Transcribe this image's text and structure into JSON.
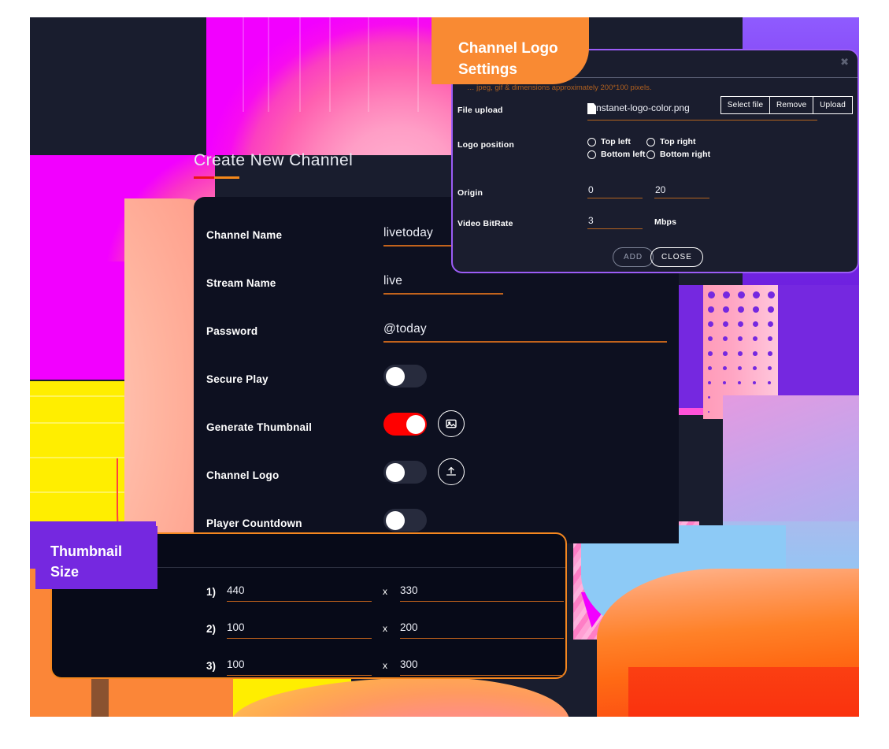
{
  "page": {
    "title": "Create New Channel"
  },
  "form": {
    "fields": [
      {
        "label": "Channel Name",
        "value": "livetoday",
        "type": "text",
        "underline_width": 152
      },
      {
        "label": "Stream Name",
        "value": "live",
        "type": "text",
        "underline_width": 152
      },
      {
        "label": "Password",
        "value": "@today",
        "type": "text",
        "underline_width": 360
      },
      {
        "label": "Secure Play",
        "type": "toggle",
        "on": false,
        "icon": null
      },
      {
        "label": "Generate Thumbnail",
        "type": "toggle",
        "on": true,
        "icon": "image-icon"
      },
      {
        "label": "Channel Logo",
        "type": "toggle",
        "on": false,
        "icon": "upload-icon"
      },
      {
        "label": "Player Countdown",
        "type": "toggle",
        "on": false,
        "icon": null
      }
    ]
  },
  "badges": {
    "logo_settings": "Channel Logo\nSettings",
    "thumbnail_size": "Thumbnail\nSize"
  },
  "modal": {
    "close_icon": "✖",
    "hint": "…  jpeg, gif & dimensions approximately 200*100 pixels.",
    "file_upload": {
      "label": "File upload",
      "value": "nstanet-logo-color.png",
      "buttons": [
        "Select file",
        "Remove",
        "Upload"
      ]
    },
    "logo_position": {
      "label": "Logo position",
      "options": [
        {
          "label": "Top left",
          "selected": false
        },
        {
          "label": "Top right",
          "selected": false
        },
        {
          "label": "Bottom left",
          "selected": false
        },
        {
          "label": "Bottom right",
          "selected": false
        }
      ]
    },
    "origin": {
      "label": "Origin",
      "x": "0",
      "y": "20"
    },
    "bitrate": {
      "label": "Video BitRate",
      "value": "3",
      "unit": "Mbps"
    },
    "actions": {
      "add": "ADD",
      "close": "CLOSE"
    }
  },
  "thumbnail_sizes": {
    "separator": "x",
    "rows": [
      {
        "num": "1)",
        "width": "440",
        "height": "330"
      },
      {
        "num": "2)",
        "width": "100",
        "height": "200"
      },
      {
        "num": "3)",
        "width": "100",
        "height": "300"
      }
    ]
  },
  "colors": {
    "accent_orange": "#f5871f",
    "accent_purple": "#7528e0",
    "toggle_on": "#ff0000",
    "underline": "#c2631c",
    "modal_border": "#9b5cf6"
  }
}
